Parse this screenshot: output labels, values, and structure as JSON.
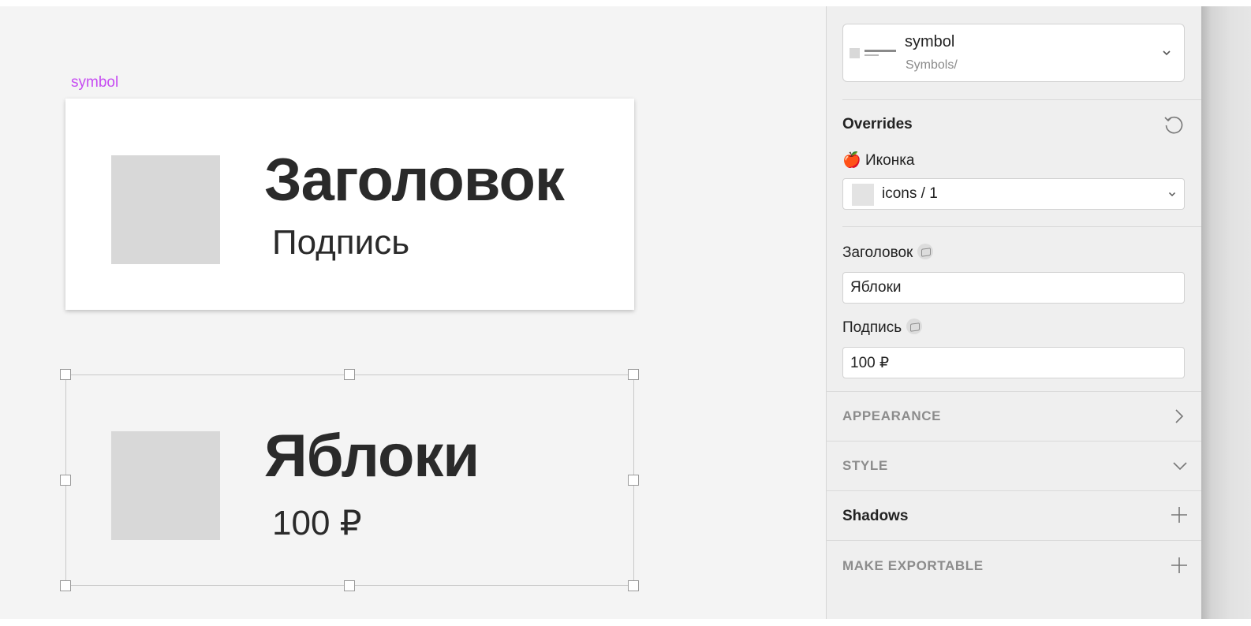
{
  "canvas": {
    "symbol_label": "symbol",
    "master": {
      "title": "Заголовок",
      "subtitle": "Подпись"
    },
    "instance": {
      "title": "Яблоки",
      "subtitle": "100 ₽"
    }
  },
  "inspector": {
    "symbol_picker": {
      "name": "symbol",
      "path": "Symbols/"
    },
    "overrides": {
      "heading": "Overrides",
      "icon_label": "Иконка",
      "icon_emoji": "🍎",
      "icon_value": "icons / 1",
      "title_label": "Заголовок",
      "title_value": "Яблоки",
      "subtitle_label": "Подпись",
      "subtitle_value": "100 ₽"
    },
    "sections": {
      "appearance": "APPEARANCE",
      "style": "STYLE",
      "shadows": "Shadows",
      "export": "MAKE EXPORTABLE"
    }
  },
  "icons": {
    "reset": "reset-icon",
    "chevron_down": "chevron-down-icon",
    "chevron_right": "chevron-right-icon",
    "plus": "plus-icon",
    "link": "symbol-link-icon"
  },
  "colors": {
    "symbol_label": "#c64bf2",
    "canvas_bg": "#f4f4f4",
    "panel_bg": "#efefef",
    "placeholder": "#d8d8d8"
  }
}
